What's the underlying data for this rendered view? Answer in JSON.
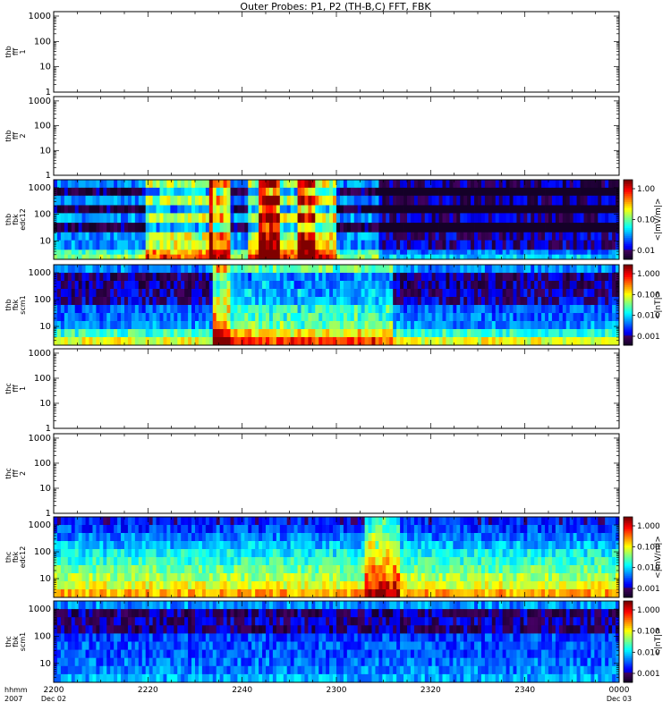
{
  "title": "Outer Probes: P1, P2 (TH-B,C) FFT, FBK",
  "colors": {
    "axis": "#000000",
    "background": "#ffffff"
  },
  "chart_data": {
    "type": "heatmap",
    "x_ticks": [
      "2200",
      "2220",
      "2240",
      "2300",
      "2320",
      "2340",
      "0000"
    ],
    "x_sub_labels": [
      {
        "tick": "2200",
        "line2": "Dec 02"
      },
      {
        "tick": "0000",
        "line2": "Dec 03"
      }
    ],
    "x_axis_label": [
      "hhmm",
      "2007"
    ],
    "y_scale": "log",
    "panels": [
      {
        "id": "thb-fft-1",
        "ylabel": [
          "thb",
          "fff",
          "1"
        ],
        "yticks": [
          "1000",
          "100",
          "10",
          "1"
        ],
        "ylim": [
          1,
          1500
        ],
        "spectrogram": false
      },
      {
        "id": "thb-fft-2",
        "ylabel": [
          "thb",
          "fff",
          "2"
        ],
        "yticks": [
          "1000",
          "100",
          "10",
          "1"
        ],
        "ylim": [
          1,
          1500
        ],
        "spectrogram": false
      },
      {
        "id": "thb-fbk-edc12",
        "ylabel": [
          "thb",
          "fbk",
          "edc12"
        ],
        "yticks": [
          "1000",
          "100",
          "10"
        ],
        "ylim": [
          2,
          2000
        ],
        "spectrogram": true,
        "colorbar": {
          "ticks": [
            "1.00",
            "0.10",
            "0.01"
          ],
          "label": "<|mV/m|>"
        },
        "scheme": "A"
      },
      {
        "id": "thb-fbk-scm1",
        "ylabel": [
          "thb",
          "fbk",
          "scm1"
        ],
        "yticks": [
          "1000",
          "100",
          "10"
        ],
        "ylim": [
          2,
          2000
        ],
        "spectrogram": true,
        "colorbar": {
          "ticks": [
            "1.000",
            "0.100",
            "0.010",
            "0.001"
          ],
          "label": "<|nT|>"
        },
        "scheme": "B"
      },
      {
        "id": "thc-fft-1",
        "ylabel": [
          "thc",
          "fff",
          "1"
        ],
        "yticks": [
          "1000",
          "100",
          "10",
          "1"
        ],
        "ylim": [
          1,
          1500
        ],
        "spectrogram": false
      },
      {
        "id": "thc-fft-2",
        "ylabel": [
          "thc",
          "fff",
          "2"
        ],
        "yticks": [
          "1000",
          "100",
          "10",
          "1"
        ],
        "ylim": [
          1,
          1500
        ],
        "spectrogram": false
      },
      {
        "id": "thc-fbk-edc12",
        "ylabel": [
          "thc",
          "fbk",
          "edc12"
        ],
        "yticks": [
          "1000",
          "100",
          "10"
        ],
        "ylim": [
          2,
          2000
        ],
        "spectrogram": true,
        "colorbar": {
          "ticks": [
            "1.000",
            "0.100",
            "0.010",
            "0.001"
          ],
          "label": "<|mV/m|>"
        },
        "scheme": "C"
      },
      {
        "id": "thc-fbk-scm1",
        "ylabel": [
          "thc",
          "fbk",
          "scm1"
        ],
        "yticks": [
          "1000",
          "100",
          "10"
        ],
        "ylim": [
          2,
          2000
        ],
        "spectrogram": true,
        "colorbar": {
          "ticks": [
            "1.000",
            "0.100",
            "0.010",
            "0.001"
          ],
          "label": "<|nT|>"
        },
        "scheme": "D"
      }
    ]
  }
}
